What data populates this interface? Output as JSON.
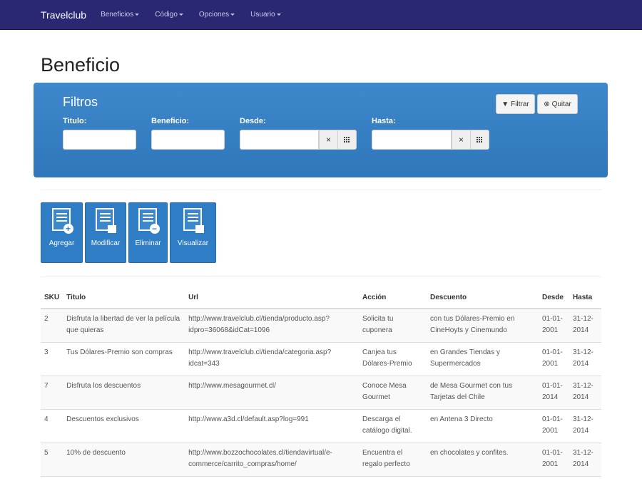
{
  "navbar": {
    "brand": "Travelclub",
    "items": [
      {
        "label": "Beneficios"
      },
      {
        "label": "Código"
      },
      {
        "label": "Opciones"
      },
      {
        "label": "Usuario"
      }
    ]
  },
  "page": {
    "title": "Beneficio"
  },
  "filters": {
    "title": "Filtros",
    "labels": {
      "titulo": "Titulo:",
      "beneficio": "Beneficio:",
      "desde": "Desde:",
      "hasta": "Hasta:"
    },
    "values": {
      "titulo": "",
      "beneficio": "",
      "desde": "",
      "hasta": ""
    },
    "filter_button": "Filtrar",
    "clear_button": "Quitar",
    "clear_addon": "×"
  },
  "actions": {
    "add": "Agregar",
    "edit": "Modificar",
    "delete": "Eliminar",
    "view": "Visualizar"
  },
  "table": {
    "headers": {
      "sku": "SKU",
      "titulo": "Titulo",
      "url": "Url",
      "accion": "Acción",
      "descuento": "Descuento",
      "desde": "Desde",
      "hasta": "Hasta"
    },
    "rows": [
      {
        "sku": "2",
        "titulo": "Disfruta la libertad de ver la película que quieras",
        "url": "http://www.travelclub.cl/tienda/producto.asp?idpro=36068&idCat=1096",
        "accion": "Solicita tu cuponera",
        "descuento": "con tus Dólares-Premio en CineHoyts y Cinemundo",
        "desde": "01-01-2001",
        "hasta": "31-12-2014"
      },
      {
        "sku": "3",
        "titulo": "Tus Dólares-Premio son compras",
        "url": "http://www.travelclub.cl/tienda/categoria.asp?idcat=343",
        "accion": "Canjea tus Dólares-Premio",
        "descuento": "en Grandes Tiendas y Supermercados",
        "desde": "01-01-2001",
        "hasta": "31-12-2014"
      },
      {
        "sku": "7",
        "titulo": "Disfruta los descuentos",
        "url": "http://www.mesagourmet.cl/",
        "accion": "Conoce Mesa Gourmet",
        "descuento": "de Mesa Gourmet con tus Tarjetas del Chile",
        "desde": "01-01-2014",
        "hasta": "31-12-2014"
      },
      {
        "sku": "4",
        "titulo": "Descuentos exclusivos",
        "url": "http://www.a3d.cl/default.asp?log=991",
        "accion": "Descarga el catálogo digital.",
        "descuento": "en Antena 3 Directo",
        "desde": "01-01-2001",
        "hasta": "31-12-2014"
      },
      {
        "sku": "5",
        "titulo": "10% de descuento",
        "url": "http://www.bozzochocolates.cl/tiendavirtual/e-commerce/carrito_compras/home/",
        "accion": "Encuentra el regalo perfecto",
        "descuento": "en chocolates y confites.",
        "desde": "01-01-2001",
        "hasta": "31-12-2014"
      }
    ]
  }
}
